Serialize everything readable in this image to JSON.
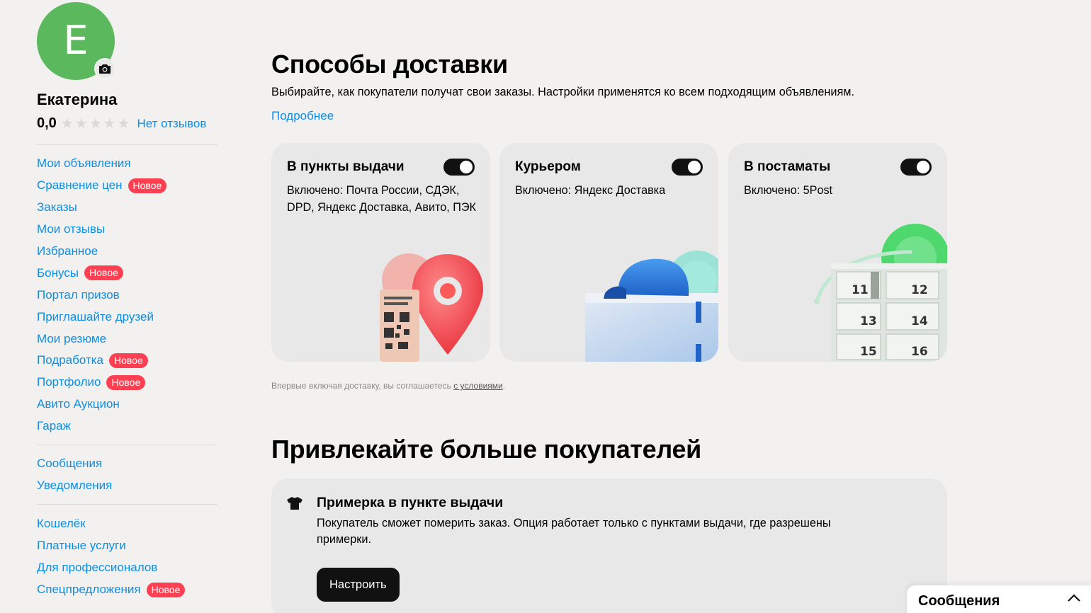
{
  "user": {
    "avatar_letter": "E",
    "name": "Екатерина",
    "rating": "0,0",
    "stars": 0,
    "reviews_link": "Нет отзывов"
  },
  "nav_main": [
    {
      "label": "Мои объявления"
    },
    {
      "label": "Сравнение цен",
      "badge": "Новое"
    },
    {
      "label": "Заказы"
    },
    {
      "label": "Мои отзывы"
    },
    {
      "label": "Избранное"
    },
    {
      "label": "Бонусы",
      "badge": "Новое"
    },
    {
      "label": "Портал призов"
    },
    {
      "label": "Приглашайте друзей"
    },
    {
      "label": "Мои резюме"
    },
    {
      "label": "Подработка",
      "badge": "Новое"
    },
    {
      "label": "Портфолио",
      "badge": "Новое"
    },
    {
      "label": "Авито Аукцион"
    },
    {
      "label": "Гараж"
    }
  ],
  "nav_comm": [
    {
      "label": "Сообщения"
    },
    {
      "label": "Уведомления"
    }
  ],
  "nav_extra": [
    {
      "label": "Кошелёк"
    },
    {
      "label": "Платные услуги"
    },
    {
      "label": "Для профессионалов"
    },
    {
      "label": "Спецпредложения",
      "badge": "Новое"
    }
  ],
  "delivery": {
    "title": "Способы доставки",
    "subtitle": "Выбирайте, как покупатели получат свои заказы. Настройки применятся ко всем подходящим объявлениям.",
    "more_link": "Подробнее",
    "cards": [
      {
        "title": "В пункты выдачи",
        "text": "Включено: Почта России, СДЭК, DPD, Яндекс Доставка, Авито, ПЭК",
        "enabled": true
      },
      {
        "title": "Курьером",
        "text": "Включено: Яндекс Доставка",
        "enabled": true
      },
      {
        "title": "В постаматы",
        "text": "Включено: 5Post",
        "enabled": true
      }
    ],
    "terms_prefix": "Впервые включая доставку, вы соглашаетесь ",
    "terms_link": "с условиями",
    "terms_suffix": "."
  },
  "locker_numbers": [
    "11",
    "12",
    "13",
    "14",
    "15",
    "16"
  ],
  "promo": {
    "title": "Привлекайте больше покупателей",
    "feature_title": "Примерка в пункте выдачи",
    "feature_text": "Покупатель сможет померить заказ. Опция работает только с пунктами выдачи, где разрешены примерки.",
    "button": "Настроить"
  },
  "messages_dock": {
    "title": "Сообщения"
  },
  "colors": {
    "link": "#0a8ee8",
    "badge": "#ff4053",
    "avatar": "#5cb85c",
    "toggle_on": "#111111",
    "background": "#f2f1f0",
    "card": "#e8e8e8"
  }
}
